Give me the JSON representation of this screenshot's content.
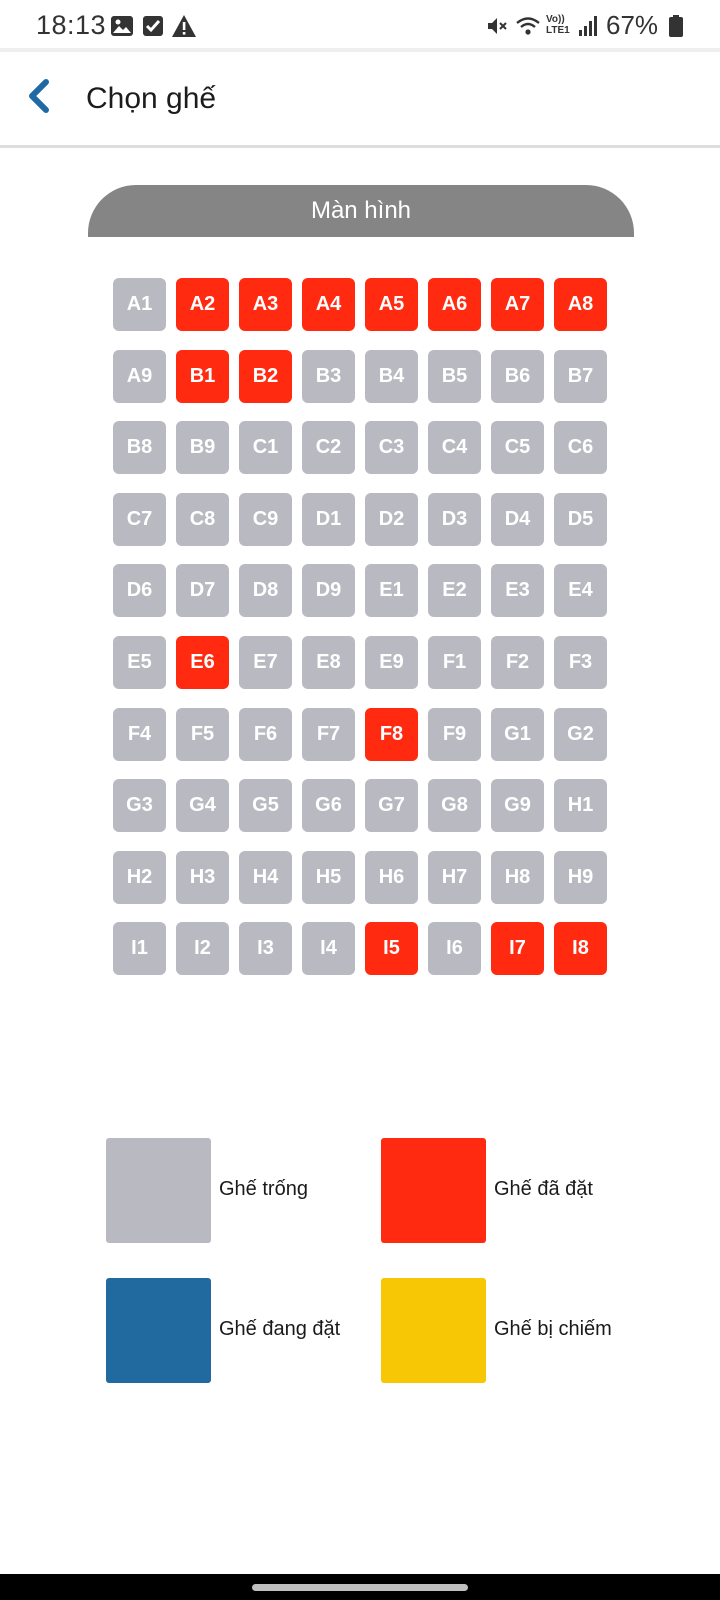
{
  "status_bar": {
    "time": "18:13",
    "left_icons": [
      "image-icon",
      "checkbox-icon",
      "warning-icon"
    ],
    "right_icons": [
      "mute-icon",
      "wifi-icon",
      "volte-icon",
      "signal-icon"
    ],
    "volte_label": "Vo)) LTE1",
    "battery_percent": "67%"
  },
  "header": {
    "back_icon": "chevron-left-icon",
    "title": "Chọn ghế"
  },
  "screen_label": "Màn hình",
  "colors": {
    "available": "#b9b9c1",
    "booked": "#ff2a10",
    "selecting": "#216aa0",
    "occupied": "#f7c605",
    "accent": "#1f6aa5"
  },
  "seats": [
    {
      "id": "A1",
      "status": "available"
    },
    {
      "id": "A2",
      "status": "booked"
    },
    {
      "id": "A3",
      "status": "booked"
    },
    {
      "id": "A4",
      "status": "booked"
    },
    {
      "id": "A5",
      "status": "booked"
    },
    {
      "id": "A6",
      "status": "booked"
    },
    {
      "id": "A7",
      "status": "booked"
    },
    {
      "id": "A8",
      "status": "booked"
    },
    {
      "id": "A9",
      "status": "available"
    },
    {
      "id": "B1",
      "status": "booked"
    },
    {
      "id": "B2",
      "status": "booked"
    },
    {
      "id": "B3",
      "status": "available"
    },
    {
      "id": "B4",
      "status": "available"
    },
    {
      "id": "B5",
      "status": "available"
    },
    {
      "id": "B6",
      "status": "available"
    },
    {
      "id": "B7",
      "status": "available"
    },
    {
      "id": "B8",
      "status": "available"
    },
    {
      "id": "B9",
      "status": "available"
    },
    {
      "id": "C1",
      "status": "available"
    },
    {
      "id": "C2",
      "status": "available"
    },
    {
      "id": "C3",
      "status": "available"
    },
    {
      "id": "C4",
      "status": "available"
    },
    {
      "id": "C5",
      "status": "available"
    },
    {
      "id": "C6",
      "status": "available"
    },
    {
      "id": "C7",
      "status": "available"
    },
    {
      "id": "C8",
      "status": "available"
    },
    {
      "id": "C9",
      "status": "available"
    },
    {
      "id": "D1",
      "status": "available"
    },
    {
      "id": "D2",
      "status": "available"
    },
    {
      "id": "D3",
      "status": "available"
    },
    {
      "id": "D4",
      "status": "available"
    },
    {
      "id": "D5",
      "status": "available"
    },
    {
      "id": "D6",
      "status": "available"
    },
    {
      "id": "D7",
      "status": "available"
    },
    {
      "id": "D8",
      "status": "available"
    },
    {
      "id": "D9",
      "status": "available"
    },
    {
      "id": "E1",
      "status": "available"
    },
    {
      "id": "E2",
      "status": "available"
    },
    {
      "id": "E3",
      "status": "available"
    },
    {
      "id": "E4",
      "status": "available"
    },
    {
      "id": "E5",
      "status": "available"
    },
    {
      "id": "E6",
      "status": "booked"
    },
    {
      "id": "E7",
      "status": "available"
    },
    {
      "id": "E8",
      "status": "available"
    },
    {
      "id": "E9",
      "status": "available"
    },
    {
      "id": "F1",
      "status": "available"
    },
    {
      "id": "F2",
      "status": "available"
    },
    {
      "id": "F3",
      "status": "available"
    },
    {
      "id": "F4",
      "status": "available"
    },
    {
      "id": "F5",
      "status": "available"
    },
    {
      "id": "F6",
      "status": "available"
    },
    {
      "id": "F7",
      "status": "available"
    },
    {
      "id": "F8",
      "status": "booked"
    },
    {
      "id": "F9",
      "status": "available"
    },
    {
      "id": "G1",
      "status": "available"
    },
    {
      "id": "G2",
      "status": "available"
    },
    {
      "id": "G3",
      "status": "available"
    },
    {
      "id": "G4",
      "status": "available"
    },
    {
      "id": "G5",
      "status": "available"
    },
    {
      "id": "G6",
      "status": "available"
    },
    {
      "id": "G7",
      "status": "available"
    },
    {
      "id": "G8",
      "status": "available"
    },
    {
      "id": "G9",
      "status": "available"
    },
    {
      "id": "H1",
      "status": "available"
    },
    {
      "id": "H2",
      "status": "available"
    },
    {
      "id": "H3",
      "status": "available"
    },
    {
      "id": "H4",
      "status": "available"
    },
    {
      "id": "H5",
      "status": "available"
    },
    {
      "id": "H6",
      "status": "available"
    },
    {
      "id": "H7",
      "status": "available"
    },
    {
      "id": "H8",
      "status": "available"
    },
    {
      "id": "H9",
      "status": "available"
    },
    {
      "id": "I1",
      "status": "available"
    },
    {
      "id": "I2",
      "status": "available"
    },
    {
      "id": "I3",
      "status": "available"
    },
    {
      "id": "I4",
      "status": "available"
    },
    {
      "id": "I5",
      "status": "booked"
    },
    {
      "id": "I6",
      "status": "available"
    },
    {
      "id": "I7",
      "status": "booked"
    },
    {
      "id": "I8",
      "status": "booked"
    }
  ],
  "legend": [
    {
      "key": "available",
      "label": "Ghế trống"
    },
    {
      "key": "booked",
      "label": "Ghế đã đặt"
    },
    {
      "key": "selecting",
      "label": "Ghế đang đặt"
    },
    {
      "key": "occupied",
      "label": "Ghế bị chiếm"
    }
  ]
}
